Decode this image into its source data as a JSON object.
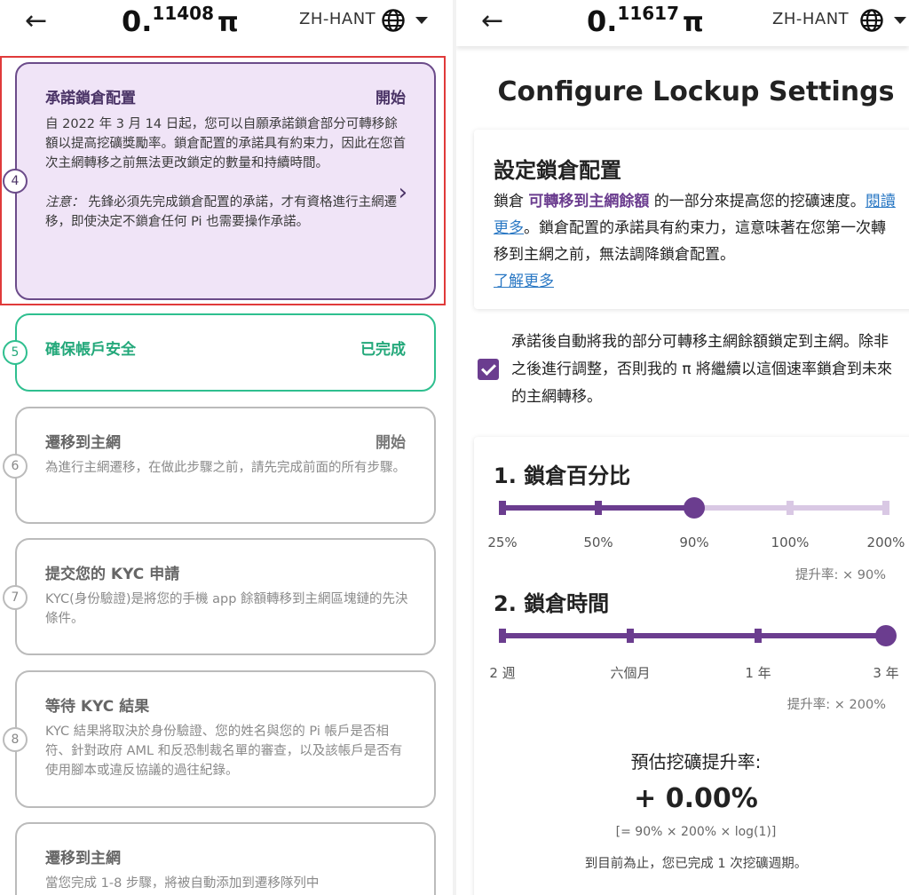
{
  "left": {
    "header": {
      "back_icon": "arrow-left-icon",
      "balance_int": "0.",
      "balance_frac": "11408",
      "pi_symbol": "π",
      "lang": "ZH-HANT"
    },
    "steps": [
      {
        "num": "4",
        "title": "承諾鎖倉配置",
        "status": "開始",
        "state": "active",
        "desc": "自 2022 年 3 月 14 日起，您可以自願承諾鎖倉部分可轉移餘額以提高挖礦獎勵率。鎖倉配置的承諾具有約束力，因此在您首次主網轉移之前無法更改鎖定的數量和持續時間。",
        "note_prefix": "注意：",
        "note": "先鋒必須先完成鎖倉配置的承諾，才有資格進行主網遷移，即使決定不鎖倉任何 Pi 也需要操作承諾。"
      },
      {
        "num": "5",
        "title": "確保帳戶安全",
        "status": "已完成",
        "state": "done"
      },
      {
        "num": "6",
        "title": "遷移到主網",
        "status": "開始",
        "state": "disabled",
        "desc": "為進行主網遷移，在做此步驟之前，請先完成前面的所有步驟。"
      },
      {
        "num": "7",
        "title": "提交您的 KYC 申請",
        "status": "",
        "state": "disabled",
        "desc": "KYC(身份驗證)是將您的手機 app 餘額轉移到主網區塊鏈的先決條件。"
      },
      {
        "num": "8",
        "title": "等待 KYC 結果",
        "status": "",
        "state": "disabled",
        "desc": "KYC 結果將取決於身份驗證、您的姓名與您的 Pi 帳戶是否相符、針對政府 AML 和反恐制裁名單的審查，以及該帳戶是否有使用腳本或違反協議的過往紀錄。"
      },
      {
        "num": "9",
        "title": "遷移到主網",
        "status": "",
        "state": "disabled",
        "desc": "當您完成 1-8 步驟，將被自動添加到遷移隊列中"
      }
    ]
  },
  "right": {
    "header": {
      "back_icon": "arrow-left-icon",
      "balance_int": "0.",
      "balance_frac": "11617",
      "pi_symbol": "π",
      "lang": "ZH-HANT"
    },
    "page_title": "Configure Lockup Settings",
    "info": {
      "title": "設定鎖倉配置",
      "t1": "鎖倉 ",
      "em": "可轉移到主網餘額",
      "t2": " 的一部分來提高您的挖礦速度。",
      "link1": "閱讀更多",
      "t3": "。鎖倉配置的承諾具有約束力，這意味著在您第一次轉移到主網之前，無法調降鎖倉配置。",
      "link2": "了解更多"
    },
    "checkbox": {
      "checked": true,
      "label": "承諾後自動將我的部分可轉移主網餘額鎖定到主網。除非之後進行調整，否則我的 π 將繼續以這個速率鎖倉到未來的主網轉移。"
    },
    "percent": {
      "heading": "1. 鎖倉百分比",
      "labels": [
        "25%",
        "50%",
        "90%",
        "100%",
        "200%"
      ],
      "selected_index": 2,
      "boost": "提升率: × 90%"
    },
    "duration": {
      "heading": "2. 鎖倉時間",
      "labels": [
        "2 週",
        "六個月",
        "1 年",
        "3 年"
      ],
      "selected_index": 3,
      "boost": "提升率: × 200%"
    },
    "estimate": {
      "label": "預估挖礦提升率:",
      "value": "+ 0.00%",
      "formula": "[= 90% × 200% × log(1)]",
      "note": "到目前為止，您已完成 1 次挖礦週期。"
    }
  },
  "colors": {
    "accent": "#6b3d8f",
    "done": "#23a87a",
    "highlight": "#e03a3a"
  }
}
